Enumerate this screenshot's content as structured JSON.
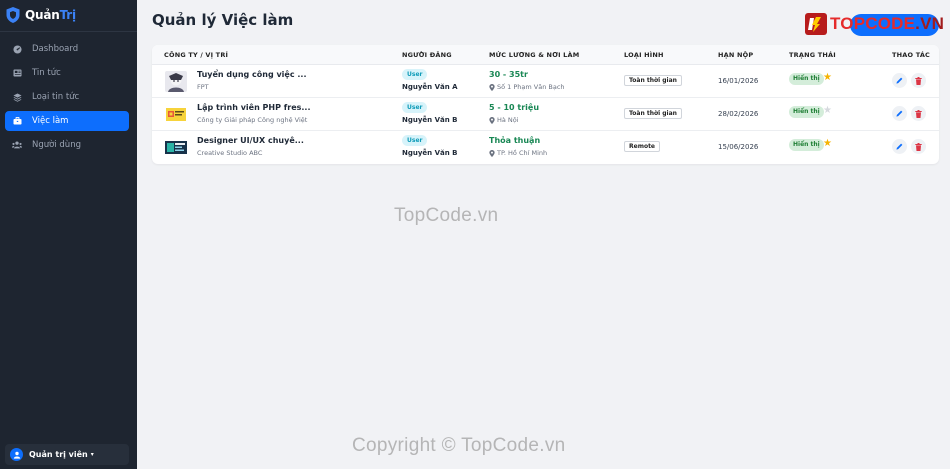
{
  "brand": {
    "name_part1": "Quản",
    "name_part2": "Trị"
  },
  "nav": [
    {
      "label": "Dashboard",
      "icon": "dashboard-icon",
      "active": false
    },
    {
      "label": "Tin tức",
      "icon": "newspaper-icon",
      "active": false
    },
    {
      "label": "Loại tin tức",
      "icon": "layers-icon",
      "active": false
    },
    {
      "label": "Việc làm",
      "icon": "briefcase-icon",
      "active": true
    },
    {
      "label": "Người dùng",
      "icon": "users-icon",
      "active": false
    }
  ],
  "user": {
    "name": "Quản trị viên",
    "caret": "▾"
  },
  "page": {
    "title": "Quản lý Việc làm"
  },
  "watermark_logo": {
    "part1": "TOPCODE",
    "part2": ".VN"
  },
  "table": {
    "headers": [
      "CÔNG TY / VỊ TRÍ",
      "NGƯỜI ĐĂNG",
      "MỨC LƯƠNG & NƠI LÀM",
      "LOẠI HÌNH",
      "HẠN NỘP",
      "TRẠNG THÁI",
      "THAO TÁC"
    ],
    "rows": [
      {
        "title": "Tuyển dụng công việc ...",
        "company": "FPT",
        "role_badge": "User",
        "poster": "Nguyễn Văn A",
        "salary": "30 - 35tr",
        "location": "Số 1 Phạm Văn Bạch",
        "type": "Toàn thời gian",
        "deadline": "16/01/2026",
        "status": "Hiển thị",
        "featured": true
      },
      {
        "title": "Lập trình viên PHP fres...",
        "company": "Công ty Giải pháp Công nghệ Việt",
        "role_badge": "User",
        "poster": "Nguyễn Văn B",
        "salary": "5 - 10 triệu",
        "location": "Hà Nội",
        "type": "Toàn thời gian",
        "deadline": "28/02/2026",
        "status": "Hiển thị",
        "featured": false
      },
      {
        "title": "Designer UI/UX chuyê...",
        "company": "Creative Studio ABC",
        "role_badge": "User",
        "poster": "Nguyễn Văn B",
        "salary": "Thỏa thuận",
        "location": "TP. Hồ Chí Minh",
        "type": "Remote",
        "deadline": "15/06/2026",
        "status": "Hiển thị",
        "featured": true
      }
    ]
  },
  "watermarks": {
    "center": "TopCode.vn",
    "bottom": "Copyright © TopCode.vn"
  },
  "colors": {
    "sidebar_bg": "#1e2530",
    "accent": "#0d6efd",
    "salary": "#198754",
    "star": "#f5b301",
    "delete": "#dc3545"
  }
}
